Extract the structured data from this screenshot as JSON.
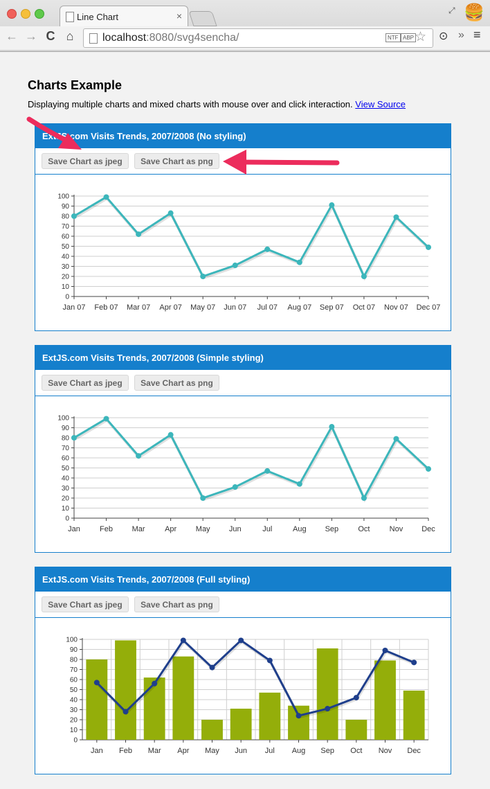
{
  "browser": {
    "tab_title": "Line Chart",
    "tab_close": "×",
    "url_host": "localhost",
    "url_rest": ":8080/svg4sencha/",
    "badge_ntf": "NTF",
    "badge_abp": "ABP",
    "back_glyph": "←",
    "forward_glyph": "→",
    "reload_glyph": "C",
    "home_glyph": "⌂",
    "star_glyph": "☆",
    "ext_glyph": "»",
    "menu_glyph": "≡",
    "profile_glyph": "🍔",
    "restore_glyph": "⤢"
  },
  "page": {
    "title": "Charts Example",
    "description": "Displaying multiple charts and mixed charts with mouse over and click interaction.",
    "link_text": "View Source"
  },
  "panels": [
    {
      "title": "ExtJS.com Visits Trends, 2007/2008 (No styling)",
      "btn_jpeg": "Save Chart as jpeg",
      "btn_png": "Save Chart as png"
    },
    {
      "title": "ExtJS.com Visits Trends, 2007/2008 (Simple styling)",
      "btn_jpeg": "Save Chart as jpeg",
      "btn_png": "Save Chart as png"
    },
    {
      "title": "ExtJS.com Visits Trends, 2007/2008 (Full styling)",
      "btn_jpeg": "Save Chart as jpeg",
      "btn_png": "Save Chart as png"
    }
  ],
  "colors": {
    "panel_blue": "#157fcc",
    "line_teal": "#3cb6bb",
    "bar_green": "#94ae0a",
    "line_navy": "#1f3f8c",
    "arrow_pink": "#ec2c5c"
  },
  "chart_data": [
    {
      "type": "line",
      "title": "",
      "categories": [
        "Jan 07",
        "Feb 07",
        "Mar 07",
        "Apr 07",
        "May 07",
        "Jun 07",
        "Jul 07",
        "Aug 07",
        "Sep 07",
        "Oct 07",
        "Nov 07",
        "Dec 07"
      ],
      "series": [
        {
          "values": [
            80,
            99,
            62,
            83,
            20,
            31,
            47,
            34,
            91,
            20,
            79,
            49
          ]
        }
      ],
      "yticks": [
        "0",
        "10",
        "20",
        "30",
        "40",
        "50",
        "60",
        "70",
        "80",
        "90",
        "100"
      ],
      "ylim": [
        0,
        100
      ],
      "grid": "horizontal"
    },
    {
      "type": "line",
      "title": "",
      "categories": [
        "Jan",
        "Feb",
        "Mar",
        "Apr",
        "May",
        "Jun",
        "Jul",
        "Aug",
        "Sep",
        "Oct",
        "Nov",
        "Dec"
      ],
      "series": [
        {
          "values": [
            80,
            99,
            62,
            83,
            20,
            31,
            47,
            34,
            91,
            20,
            79,
            49
          ]
        }
      ],
      "yticks": [
        "0",
        "10",
        "20",
        "30",
        "40",
        "50",
        "60",
        "70",
        "80",
        "90",
        "100"
      ],
      "ylim": [
        0,
        100
      ],
      "grid": "horizontal"
    },
    {
      "type": "bar",
      "title": "",
      "categories": [
        "Jan",
        "Feb",
        "Mar",
        "Apr",
        "May",
        "Jun",
        "Jul",
        "Aug",
        "Sep",
        "Oct",
        "Nov",
        "Dec"
      ],
      "series": [
        {
          "kind": "bar",
          "values": [
            80,
            99,
            62,
            83,
            20,
            31,
            47,
            34,
            91,
            20,
            79,
            49
          ]
        },
        {
          "kind": "line",
          "values": [
            57,
            28,
            56,
            99,
            72,
            99,
            79,
            24,
            31,
            42,
            89,
            77
          ]
        }
      ],
      "yticks": [
        "0",
        "10",
        "20",
        "30",
        "40",
        "50",
        "60",
        "70",
        "80",
        "90",
        "100"
      ],
      "ylim": [
        0,
        100
      ],
      "grid": "both"
    }
  ]
}
